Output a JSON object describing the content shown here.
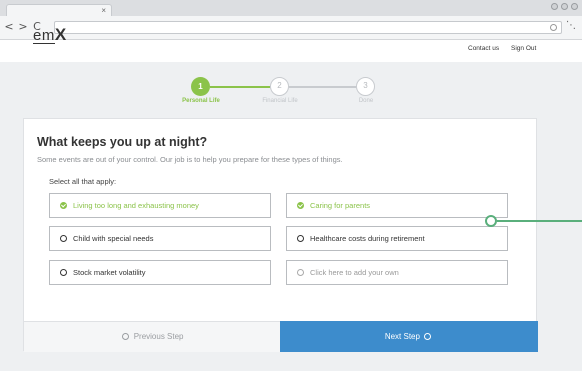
{
  "browser": {
    "tab_close": "×",
    "nav_back": "<",
    "nav_forward": ">",
    "nav_reload": "C"
  },
  "header": {
    "logo_prefix": "em",
    "logo_suffix": "X",
    "links": [
      "Contact us",
      "Sign Out"
    ]
  },
  "stepper": {
    "steps": [
      {
        "number": "1",
        "label": "Personal Life",
        "state": "active"
      },
      {
        "number": "2",
        "label": "Financial Life",
        "state": "inactive"
      },
      {
        "number": "3",
        "label": "Done",
        "state": "inactive"
      }
    ]
  },
  "question": {
    "title": "What keeps you up at night?",
    "subtitle": "Some events are out of your control. Our job is to help you prepare for these types of things.",
    "instruction": "Select all that apply:"
  },
  "options": [
    {
      "label": "Living too long and exhausting money",
      "selected": true
    },
    {
      "label": "Caring for parents",
      "selected": true
    },
    {
      "label": "Child with special needs",
      "selected": false
    },
    {
      "label": "Healthcare costs during retirement",
      "selected": false
    },
    {
      "label": "Stock market volatility",
      "selected": false
    },
    {
      "label": "Click here to add your own",
      "selected": false
    }
  ],
  "footer": {
    "prev_label": "Previous Step",
    "next_label": "Next Step"
  },
  "colors": {
    "accent_green": "#8bc34a",
    "primary_blue": "#3d8ccc",
    "callout_green": "#5aaf7c"
  }
}
